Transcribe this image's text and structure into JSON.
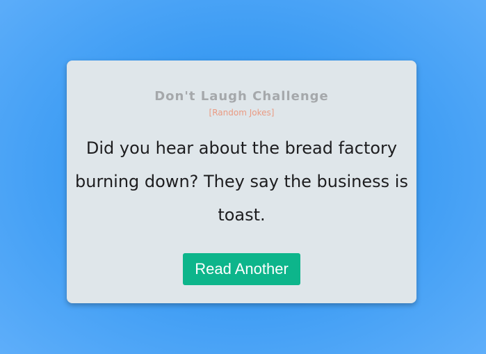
{
  "card": {
    "title": "Don't Laugh Challenge",
    "subtitle": "[Random Jokes]",
    "joke": "Did you hear about the bread factory burning down? They say the business is toast.",
    "button_label": "Read Another"
  },
  "colors": {
    "background": "#3b9bf3",
    "card_background": "#dfe6ea",
    "title": "#a5a8ab",
    "subtitle": "#ea9a82",
    "joke_text": "#1d1d1f",
    "button_background": "#0db58b",
    "button_text": "#ffffff"
  }
}
